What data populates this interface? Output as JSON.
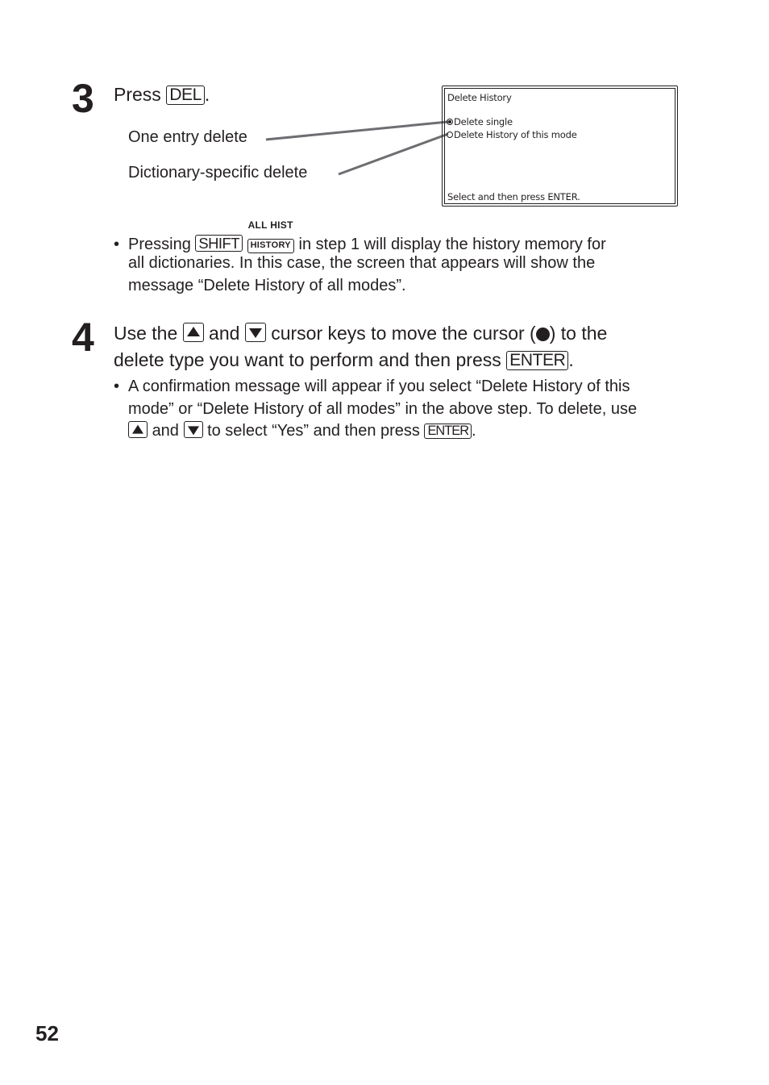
{
  "step3": {
    "number": "3",
    "press_label": "Press",
    "key_del": "DEL",
    "period": ".",
    "callout_one_entry": "One entry delete",
    "callout_dictionary": "Dictionary-specific delete",
    "screen": {
      "title": "Delete History",
      "options": [
        {
          "label": "Delete single",
          "selected": true
        },
        {
          "label": "Delete History of this mode",
          "selected": false
        }
      ],
      "footer": "Select and then press ENTER."
    },
    "note": {
      "prefix": "Pressing",
      "key_shift": "SHIFT",
      "key_history_over": "ALL HIST",
      "key_history": "HISTORY",
      "line1_rest": "in step 1 will display the history memory for",
      "line2": "all dictionaries. In this case, the screen that appears will show the",
      "line3": "message “Delete History of all modes”."
    }
  },
  "step4": {
    "number": "4",
    "line1_a": "Use the",
    "and1": "and",
    "line1_b": "cursor keys to move the cursor (",
    "line1_c": ") to the",
    "line2_a": "delete type you want to perform and then press",
    "key_enter": "ENTER",
    "period": ".",
    "note": {
      "line1": "A confirmation message will appear if you select “Delete History of this",
      "line2": "mode” or “Delete History of all modes” in the above step. To delete, use",
      "line3_and": "and",
      "line3_rest": "to select “Yes” and then press",
      "key_enter": "ENTER",
      "period": "."
    }
  },
  "page_number": "52"
}
